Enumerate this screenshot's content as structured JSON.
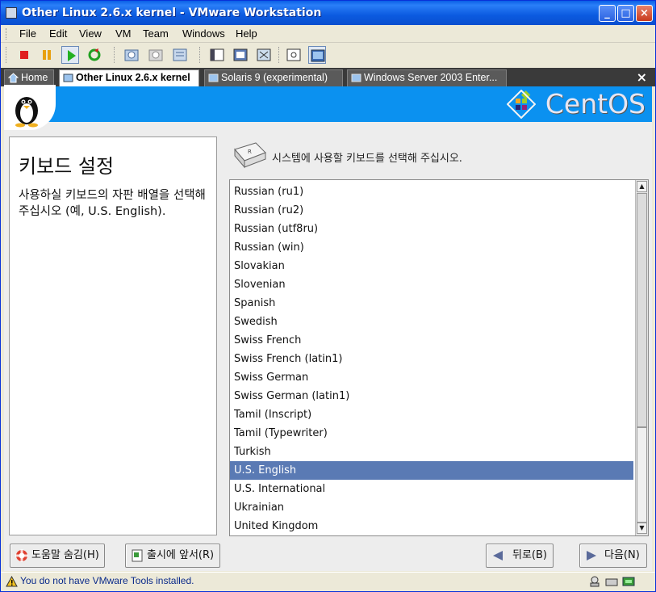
{
  "window": {
    "title": "Other Linux 2.6.x kernel - VMware Workstation",
    "controls": {
      "minimize": "_",
      "maximize": "□",
      "close": "×"
    }
  },
  "menu": [
    {
      "label": "File"
    },
    {
      "label": "Edit"
    },
    {
      "label": "View"
    },
    {
      "label": "VM"
    },
    {
      "label": "Team"
    },
    {
      "label": "Windows"
    },
    {
      "label": "Help"
    }
  ],
  "toolbar": {
    "icons": [
      "stop-icon",
      "pause-icon",
      "play-icon",
      "reset-icon",
      "snapshot-icon",
      "revert-snapshot-icon",
      "snapshot-manager-icon",
      "quick-switch-icon",
      "full-screen-icon",
      "fit-icon",
      "summary-icon",
      "console-icon"
    ]
  },
  "tabs": [
    {
      "label": "Home",
      "active": false
    },
    {
      "label": "Other Linux 2.6.x kernel",
      "active": true
    },
    {
      "label": "Solaris 9 (experimental)",
      "active": false
    },
    {
      "label": "Windows Server 2003 Enter...",
      "active": false
    }
  ],
  "tab_close": "×",
  "guest": {
    "brand": "CentOS",
    "left_title": "키보드 설정",
    "left_description": "사용하실 키보드의 자판 배열을 선택해 주십시오 (예, U.S. English).",
    "prompt": "시스템에 사용할 키보드를 선택해 주십시오.",
    "keyboard_list": [
      "Russian (ru1)",
      "Russian (ru2)",
      "Russian (utf8ru)",
      "Russian (win)",
      "Slovakian",
      "Slovenian",
      "Spanish",
      "Swedish",
      "Swiss French",
      "Swiss French (latin1)",
      "Swiss German",
      "Swiss German (latin1)",
      "Tamil (Inscript)",
      "Tamil (Typewriter)",
      "Turkish",
      "U.S. English",
      "U.S. International",
      "Ukrainian",
      "United Kingdom"
    ],
    "selected": "U.S. English",
    "buttons": {
      "hide_help": "도움말 숨김(H)",
      "release_notes": "출시에 앞서(R)",
      "back": "뒤로(B)",
      "next": "다음(N)"
    }
  },
  "status": {
    "message": "You do not have VMware Tools installed."
  },
  "colors": {
    "title_bar": "#0a5fe6",
    "banner": "#0b91f0",
    "selection": "#5a7ab4"
  }
}
